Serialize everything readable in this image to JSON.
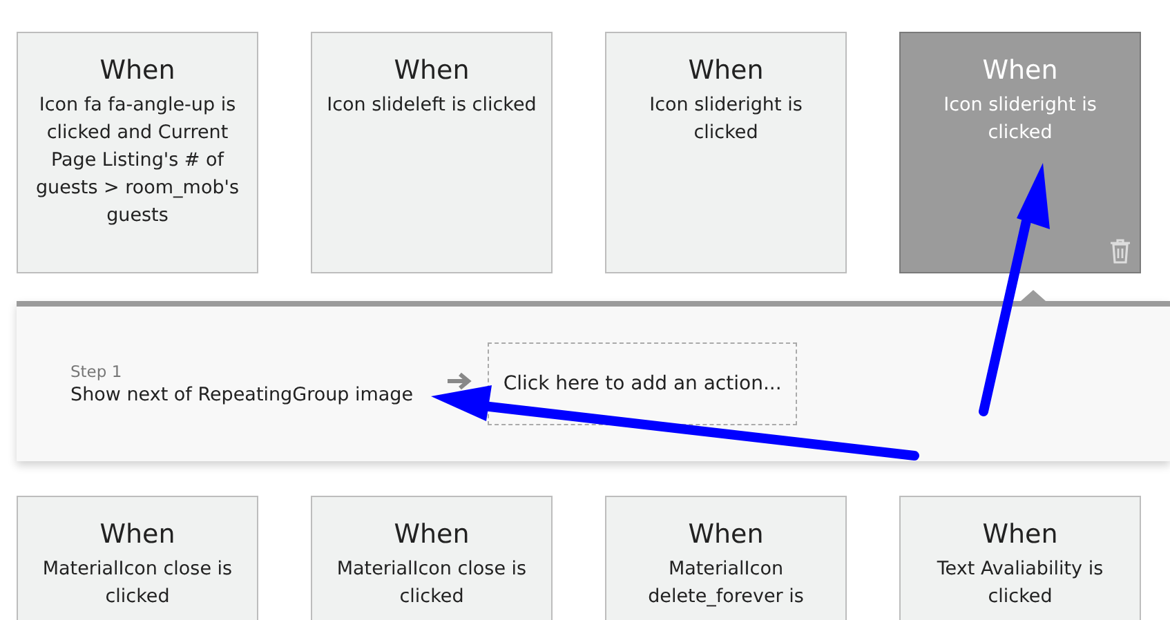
{
  "top_conditions": [
    {
      "title": "When",
      "description": "Icon fa fa-angle-up is clicked and Current Page Listing's # of guests > room_mob's guests",
      "selected": false
    },
    {
      "title": "When",
      "description": "Icon slideleft is clicked",
      "selected": false
    },
    {
      "title": "When",
      "description": "Icon slideright is clicked",
      "selected": false
    },
    {
      "title": "When",
      "description": "Icon slideright is clicked",
      "selected": true
    }
  ],
  "steps": {
    "step_label": "Step 1",
    "action": "Show next of RepeatingGroup image",
    "add_action": "Click here to add an action..."
  },
  "bottom_conditions": [
    {
      "title": "When",
      "description": "MaterialIcon close is clicked",
      "selected": false
    },
    {
      "title": "When",
      "description": "MaterialIcon close is clicked",
      "selected": false
    },
    {
      "title": "When",
      "description": "MaterialIcon delete_forever is",
      "selected": false
    },
    {
      "title": "When",
      "description": "Text Avaliability is clicked",
      "selected": false
    }
  ]
}
